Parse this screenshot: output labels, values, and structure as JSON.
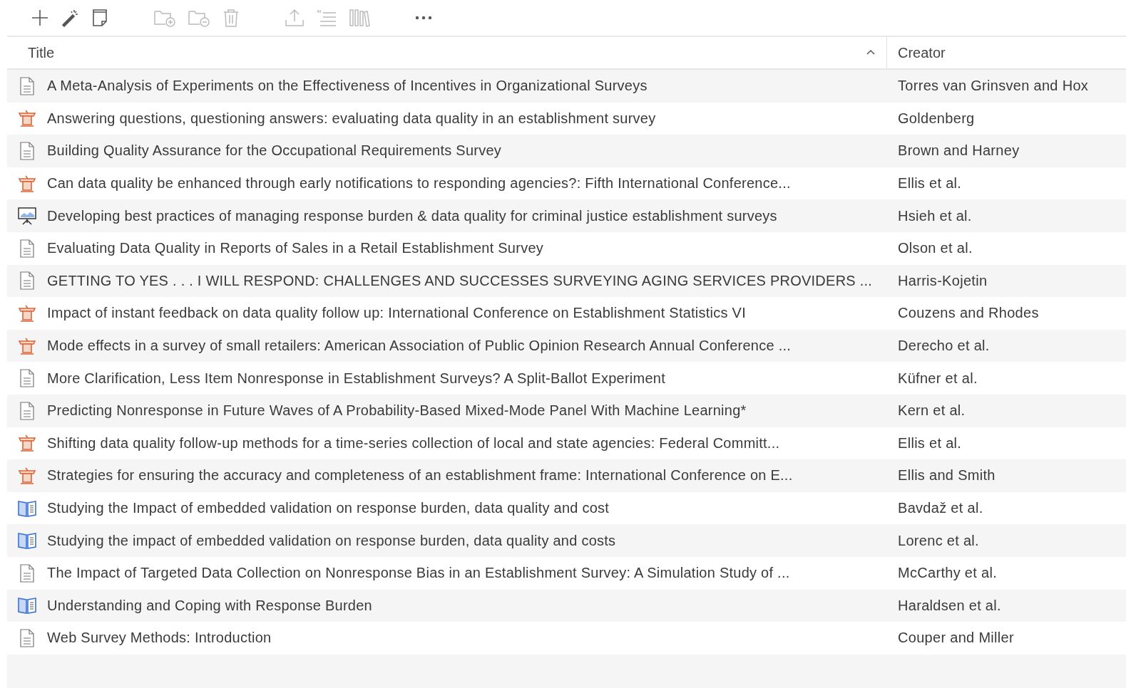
{
  "toolbar": [
    {
      "kind": "plus",
      "disabled": false
    },
    {
      "kind": "wand",
      "disabled": false
    },
    {
      "kind": "note",
      "disabled": false
    },
    {
      "kind": "folder-plus",
      "disabled": true
    },
    {
      "kind": "folder-minus",
      "disabled": true
    },
    {
      "kind": "trash",
      "disabled": true
    },
    {
      "kind": "upload",
      "disabled": true
    },
    {
      "kind": "quote",
      "disabled": true
    },
    {
      "kind": "library",
      "disabled": true
    },
    {
      "kind": "more",
      "disabled": false
    }
  ],
  "table": {
    "columns": [
      {
        "label": "Title",
        "sorted": true
      },
      {
        "label": "Creator"
      }
    ],
    "rows": [
      {
        "kind": "document",
        "title": "A Meta-Analysis of Experiments on the Effectiveness of Incentives in Organizational Surveys",
        "creator": "Torres van Grinsven and Hox"
      },
      {
        "kind": "presentation",
        "title": "Answering questions, questioning answers: evaluating data quality in an establishment survey",
        "creator": "Goldenberg"
      },
      {
        "kind": "document",
        "title": "Building Quality Assurance for the Occupational Requirements Survey",
        "creator": "Brown and Harney"
      },
      {
        "kind": "presentation",
        "title": "Can data quality be enhanced through early notifications to responding agencies?: Fifth International Conference...",
        "creator": "Ellis et al."
      },
      {
        "kind": "slides",
        "title": "Developing best practices of managing response burden & data quality for criminal justice establishment surveys",
        "creator": "Hsieh et al."
      },
      {
        "kind": "document",
        "title": "Evaluating Data Quality in Reports of Sales in a Retail Establishment Survey",
        "creator": "Olson et al."
      },
      {
        "kind": "document",
        "title": "GETTING TO YES . . . I WILL RESPOND: CHALLENGES AND SUCCESSES SURVEYING AGING SERVICES PROVIDERS ...",
        "creator": "Harris-Kojetin"
      },
      {
        "kind": "presentation",
        "title": "Impact of instant feedback on data quality follow up: International Conference on Establishment Statistics VI",
        "creator": "Couzens and Rhodes"
      },
      {
        "kind": "presentation",
        "title": "Mode effects in a survey of small retailers: American Association of Public Opinion Research Annual Conference ...",
        "creator": "Derecho et al."
      },
      {
        "kind": "document",
        "title": "More Clarification, Less Item Nonresponse in Establishment Surveys? A Split-Ballot Experiment",
        "creator": "Küfner et al."
      },
      {
        "kind": "document",
        "title": "Predicting Nonresponse in Future Waves of A Probability-Based Mixed-Mode Panel With Machine Learning*",
        "creator": "Kern et al."
      },
      {
        "kind": "presentation",
        "title": "Shifting data quality follow-up methods for a time-series collection of local and state agencies: Federal Committ...",
        "creator": "Ellis et al."
      },
      {
        "kind": "presentation",
        "title": "Strategies for ensuring the accuracy and completeness of an establishment frame: International Conference on E...",
        "creator": "Ellis and Smith"
      },
      {
        "kind": "book",
        "title": "Studying the Impact of embedded validation on response burden, data quality and cost",
        "creator": "Bavdaž et al."
      },
      {
        "kind": "book",
        "title": "Studying the impact of embedded validation on response burden, data quality and costs",
        "creator": "Lorenc et al."
      },
      {
        "kind": "document",
        "title": "The Impact of Targeted Data Collection on Nonresponse Bias in an Establishment Survey: A Simulation Study of ...",
        "creator": "McCarthy et al."
      },
      {
        "kind": "book",
        "title": "Understanding and Coping with Response Burden",
        "creator": "Haraldsen et al."
      },
      {
        "kind": "document",
        "title": "Web Survey Methods: Introduction",
        "creator": "Couper and Miller"
      }
    ]
  }
}
